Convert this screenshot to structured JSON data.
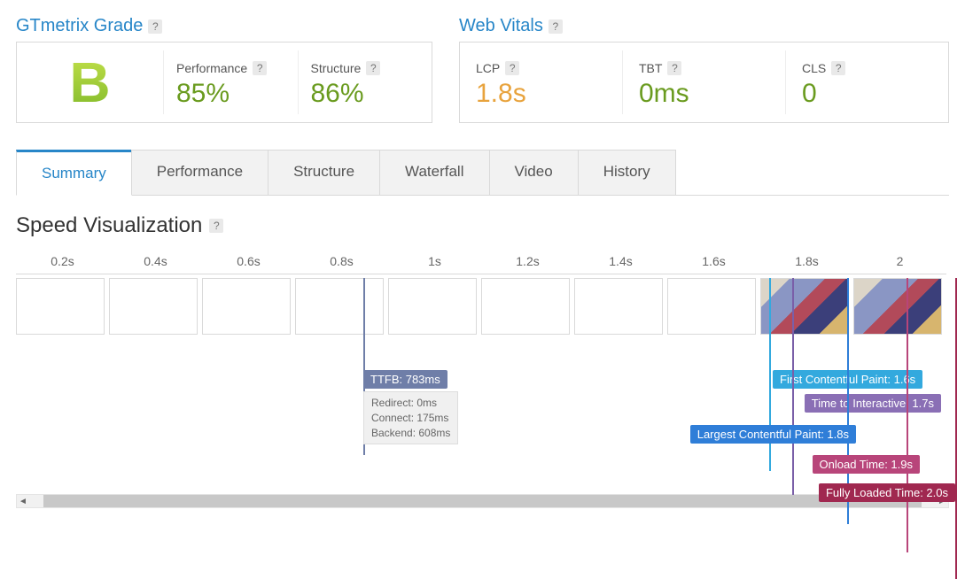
{
  "grade": {
    "title": "GTmetrix Grade",
    "letter": "B",
    "performance_label": "Performance",
    "performance_value": "85%",
    "structure_label": "Structure",
    "structure_value": "86%"
  },
  "vitals": {
    "title": "Web Vitals",
    "lcp_label": "LCP",
    "lcp_value": "1.8s",
    "tbt_label": "TBT",
    "tbt_value": "0ms",
    "cls_label": "CLS",
    "cls_value": "0"
  },
  "tabs": {
    "summary": "Summary",
    "performance": "Performance",
    "structure": "Structure",
    "waterfall": "Waterfall",
    "video": "Video",
    "history": "History"
  },
  "speed": {
    "title": "Speed Visualization",
    "ticks": [
      "0.2s",
      "0.4s",
      "0.6s",
      "0.8s",
      "1s",
      "1.2s",
      "1.4s",
      "1.6s",
      "1.8s",
      "2"
    ],
    "ttfb_label": "TTFB: 783ms",
    "ttfb_redirect": "Redirect: 0ms",
    "ttfb_connect": "Connect: 175ms",
    "ttfb_backend": "Backend: 608ms",
    "fcp_label": "First Contentful Paint: 1.6s",
    "tti_label": "Time to Interactive: 1.7s",
    "lcp_label": "Largest Contentful Paint: 1.8s",
    "onload_label": "Onload Time: 1.9s",
    "fully_label": "Fully Loaded Time: 2.0s"
  },
  "help": "?"
}
